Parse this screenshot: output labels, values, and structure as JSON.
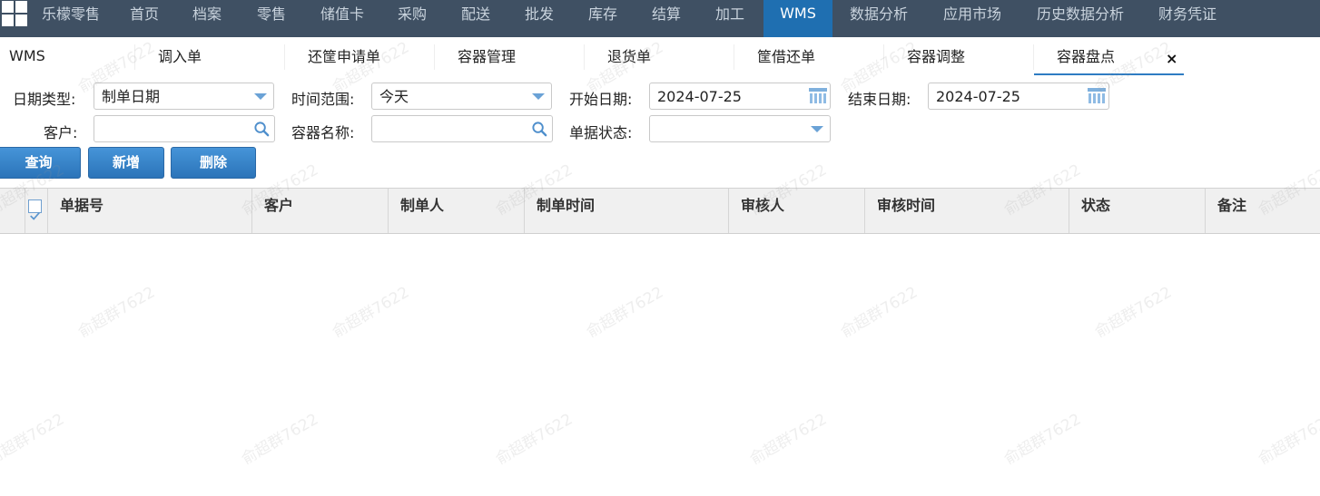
{
  "topnav": {
    "items": [
      "乐檬零售",
      "首页",
      "档案",
      "零售",
      "储值卡",
      "采购",
      "配送",
      "批发",
      "库存",
      "结算",
      "加工",
      "WMS",
      "数据分析",
      "应用市场",
      "历史数据分析",
      "财务凭证"
    ],
    "active": "WMS"
  },
  "tabs": {
    "home": "WMS",
    "items": [
      "调入单",
      "还筐申请单",
      "容器管理",
      "退货单",
      "筐借还单",
      "容器调整",
      "容器盘点"
    ],
    "active": "容器盘点",
    "close": "×"
  },
  "filters": {
    "date_type_label": "日期类型:",
    "date_type_value": "制单日期",
    "time_range_label": "时间范围:",
    "time_range_value": "今天",
    "start_date_label": "开始日期:",
    "start_date_value": "2024-07-25",
    "end_date_label": "结束日期:",
    "end_date_value": "2024-07-25",
    "customer_label": "客户:",
    "customer_value": "",
    "container_label": "容器名称:",
    "container_value": "",
    "status_label": "单据状态:",
    "status_value": ""
  },
  "buttons": {
    "query": "查询",
    "add": "新增",
    "delete": "删除"
  },
  "table": {
    "columns": [
      "单据号",
      "客户",
      "制单人",
      "制单时间",
      "审核人",
      "审核时间",
      "状态",
      "备注"
    ],
    "rows": []
  },
  "watermark": "俞超群7622",
  "colors": {
    "nav_bg": "#3f5063",
    "nav_active": "#1f6fb1",
    "button": "#2e7cc3"
  }
}
